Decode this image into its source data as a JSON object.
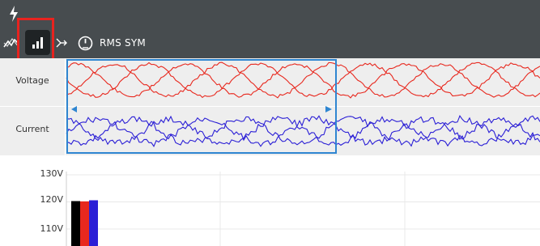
{
  "toolbar": {
    "rms_label": "RMS",
    "sym_label": "SYM"
  },
  "waveform_rows": {
    "voltage_label": "Voltage",
    "current_label": "Current"
  },
  "colors": {
    "voltage": "#e8281e",
    "current": "#2b1fd6",
    "selection": "#2f86d1",
    "highlight": "#e8231f",
    "toolbar_bg": "#474c4f"
  },
  "chart_data": {
    "type": "bar",
    "ylabels": [
      "130V",
      "120V",
      "110V"
    ],
    "yticks": [
      130,
      120,
      110
    ],
    "series": [
      {
        "color": "#000000",
        "value": 120.3
      },
      {
        "color": "#e8281e",
        "value": 120.2
      },
      {
        "color": "#2b1fd6",
        "value": 120.6
      }
    ]
  }
}
